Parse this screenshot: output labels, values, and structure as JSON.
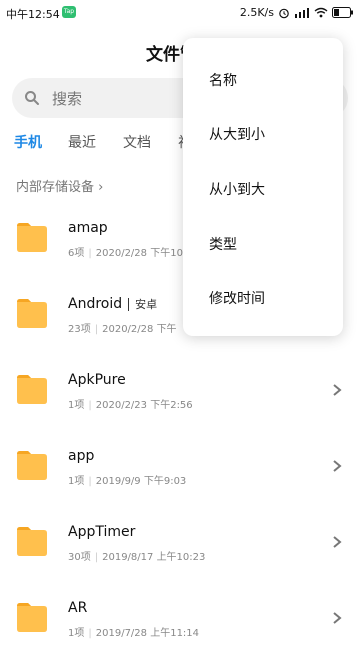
{
  "status_bar": {
    "time": "中午12:54",
    "app_badge": "Tap",
    "speed": "2.5K/s",
    "battery_percent": 30
  },
  "header": {
    "title": "文件管理"
  },
  "search": {
    "placeholder": "搜索"
  },
  "tabs": [
    {
      "label": "手机",
      "active": true
    },
    {
      "label": "最近",
      "active": false
    },
    {
      "label": "文档",
      "active": false
    },
    {
      "label": "视",
      "active": false
    }
  ],
  "breadcrumb": {
    "label": "内部存储设备",
    "chevron": "›"
  },
  "files": [
    {
      "name": "amap",
      "tag": "",
      "count": "6项",
      "date": "2020/2/28 下午10"
    },
    {
      "name": "Android",
      "tag": "安卓",
      "count": "23项",
      "date": "2020/2/28 下午"
    },
    {
      "name": "ApkPure",
      "tag": "",
      "count": "1项",
      "date": "2020/2/23 下午2:56"
    },
    {
      "name": "app",
      "tag": "",
      "count": "1项",
      "date": "2019/9/9 下午9:03"
    },
    {
      "name": "AppTimer",
      "tag": "",
      "count": "30项",
      "date": "2019/8/17 上午10:23"
    },
    {
      "name": "AR",
      "tag": "",
      "count": "1项",
      "date": "2019/7/28 上午11:14"
    }
  ],
  "sort_menu": {
    "items": [
      "名称",
      "从大到小",
      "从小到大",
      "类型",
      "修改时间"
    ]
  },
  "colors": {
    "accent": "#1e88e5",
    "folder": "#ffc04d",
    "folder_tab": "#f6a623"
  }
}
